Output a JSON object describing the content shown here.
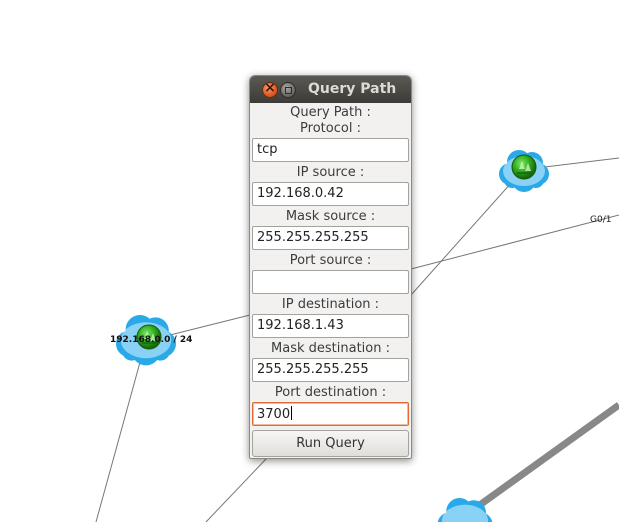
{
  "dialog": {
    "title": "Query Path",
    "heading": "Query Path :",
    "fields": [
      {
        "label": "Protocol :",
        "value": "tcp"
      },
      {
        "label": "IP source :",
        "value": "192.168.0.42"
      },
      {
        "label": "Mask source :",
        "value": "255.255.255.255"
      },
      {
        "label": "Port source :",
        "value": ""
      },
      {
        "label": "IP destination :",
        "value": "192.168.1.43"
      },
      {
        "label": "Mask destination :",
        "value": "255.255.255.255"
      },
      {
        "label": "Port destination :",
        "value": "3700"
      }
    ],
    "run_button": "Run Query"
  },
  "topology": {
    "node_label": "192.168.0.0 / 24",
    "link_label": "G0/1",
    "colors": {
      "cloud": "#29a9e8",
      "router": "#2fae1f",
      "link": "#777777",
      "thick_link": "#888888"
    },
    "icons": [
      "close-icon",
      "maximize-icon",
      "cloud-network-icon",
      "router-icon"
    ]
  }
}
